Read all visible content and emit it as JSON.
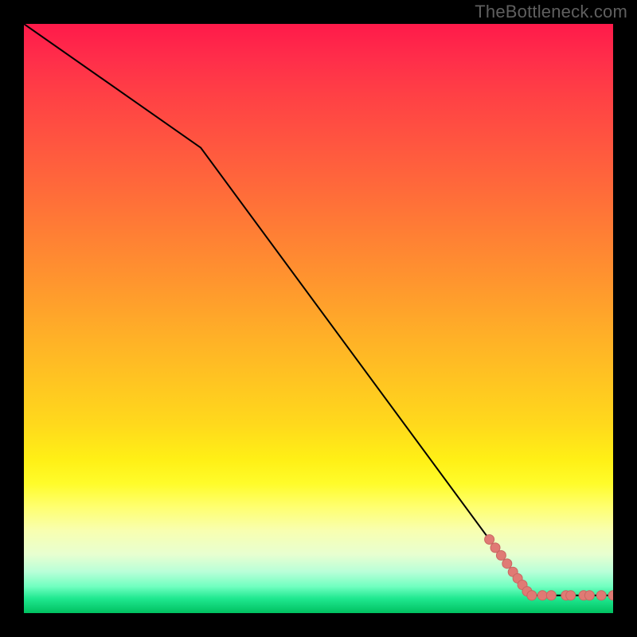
{
  "watermark": "TheBottleneck.com",
  "colors": {
    "line": "#000000",
    "marker_fill": "#e07a74",
    "marker_stroke": "#c96762",
    "frame_bg": "#000000"
  },
  "chart_data": {
    "type": "line",
    "title": "",
    "xlabel": "",
    "ylabel": "",
    "xlim": [
      0,
      100
    ],
    "ylim": [
      0,
      100
    ],
    "series": [
      {
        "name": "curve",
        "x": [
          0,
          30,
          86,
          100
        ],
        "y": [
          100,
          79,
          3,
          3
        ],
        "draw_markers": false
      },
      {
        "name": "highlight-points",
        "x": [
          79,
          80,
          81,
          82,
          83,
          83.8,
          84.6,
          85.4,
          86.2,
          86.2,
          88,
          89.5,
          92,
          92.8,
          95,
          96,
          98,
          100
        ],
        "y": [
          12.5,
          11.1,
          9.8,
          8.4,
          7.0,
          5.9,
          4.8,
          3.7,
          3,
          3,
          3,
          3,
          3,
          3,
          3,
          3,
          3,
          3
        ],
        "draw_markers": true
      }
    ],
    "marker_radius": 6
  }
}
